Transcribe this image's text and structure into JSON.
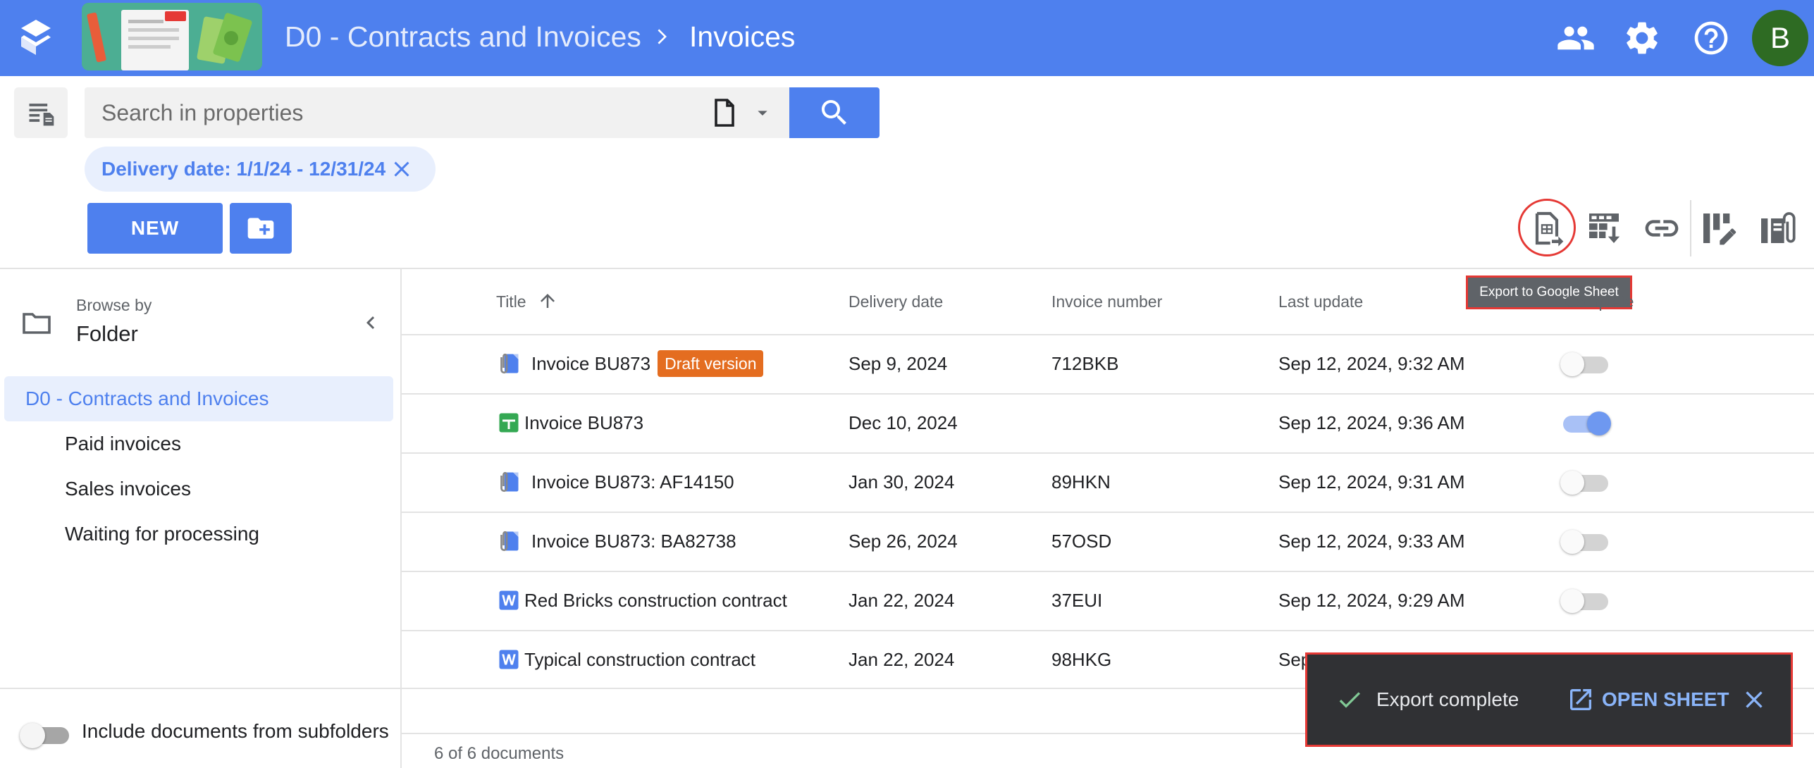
{
  "header": {
    "breadcrumb_root": "D0 - Contracts and Invoices",
    "breadcrumb_current": "Invoices",
    "avatar_initial": "B",
    "icons": [
      "app-logo",
      "folder-thumbnail",
      "chevron-right-icon",
      "people-icon",
      "gear-icon",
      "help-icon"
    ]
  },
  "search": {
    "placeholder": "Search in properties",
    "filter_chip": "Delivery date: 1/1/24 - 12/31/24"
  },
  "toolbar": {
    "new_label": "NEW",
    "tooltip": "Export to Google Sheet",
    "icons": [
      "export-google-sheet-icon",
      "import-table-icon",
      "link-icon",
      "bulk-edit-icon",
      "document-attachments-icon"
    ]
  },
  "sidebar": {
    "browse_by_label": "Browse by",
    "browse_by_value": "Folder",
    "root": "D0 - Contracts and Invoices",
    "children": [
      "Paid invoices",
      "Sales invoices",
      "Waiting for processing"
    ],
    "subfolders_label": "Include documents from subfolders",
    "subfolders_on": false
  },
  "table": {
    "columns": [
      "Title",
      "Delivery date",
      "Invoice number",
      "Last update",
      "Complete"
    ],
    "sort_column": "Title",
    "sort_direction": "ascending",
    "rows": [
      {
        "icon": "pdf-attachment-icon",
        "title": "Invoice BU873",
        "badge": "Draft version",
        "delivery": "Sep 9, 2024",
        "invoice": "712BKB",
        "updated": "Sep 12, 2024, 9:32 AM",
        "complete": false
      },
      {
        "icon": "google-sheets-icon",
        "title": "Invoice BU873",
        "badge": "",
        "delivery": "Dec 10, 2024",
        "invoice": "",
        "updated": "Sep 12, 2024, 9:36 AM",
        "complete": true
      },
      {
        "icon": "pdf-attachment-icon",
        "title": "Invoice BU873: AF14150",
        "badge": "",
        "delivery": "Jan 30, 2024",
        "invoice": "89HKN",
        "updated": "Sep 12, 2024, 9:31 AM",
        "complete": false
      },
      {
        "icon": "pdf-attachment-icon",
        "title": "Invoice BU873: BA82738",
        "badge": "",
        "delivery": "Sep 26, 2024",
        "invoice": "57OSD",
        "updated": "Sep 12, 2024, 9:33 AM",
        "complete": false
      },
      {
        "icon": "word-doc-icon",
        "title": "Red Bricks construction contract",
        "badge": "",
        "delivery": "Jan 22, 2024",
        "invoice": "37EUI",
        "updated": "Sep 12, 2024, 9:29 AM",
        "complete": false
      },
      {
        "icon": "word-doc-icon",
        "title": "Typical construction contract",
        "badge": "",
        "delivery": "Jan 22, 2024",
        "invoice": "98HKG",
        "updated": "Sep",
        "complete": false
      }
    ],
    "footer": "6 of 6 documents"
  },
  "snackbar": {
    "message": "Export complete",
    "action": "OPEN SHEET"
  },
  "colors": {
    "brand": "#4e80ee",
    "badge": "#e46d20",
    "sheets_green": "#34a853",
    "highlight": "#e53935"
  }
}
